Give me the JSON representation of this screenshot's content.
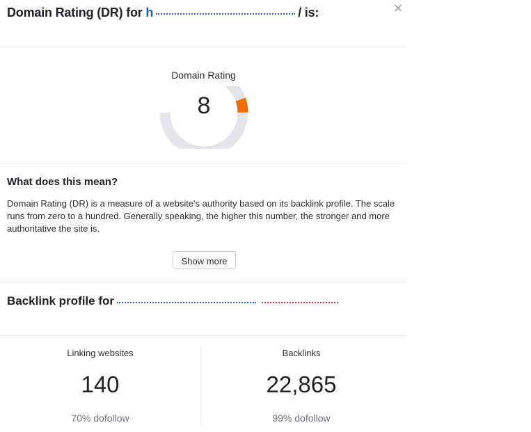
{
  "header": {
    "title_prefix": "Domain Rating (DR) for",
    "title_link": "h",
    "title_suffix": "/ is:",
    "close_glyph": "×"
  },
  "domain_rating": {
    "label": "Domain Rating",
    "value": 8,
    "max": 100,
    "fill_color": "#f06c00",
    "track_color": "#e4e5ea"
  },
  "meaning": {
    "heading": "What does this mean?",
    "body": "Domain Rating (DR) is a measure of a website's authority based on its backlink profile. The scale runs from zero to a hundred. Generally speaking, the higher this number, the stronger and more authoritative the site is.",
    "show_more_label": "Show more"
  },
  "backlink_profile": {
    "title_prefix": "Backlink profile for"
  },
  "stats": {
    "linking_websites": {
      "label": "Linking websites",
      "value": "140",
      "sub": "70% dofollow"
    },
    "backlinks": {
      "label": "Backlinks",
      "value": "22,865",
      "sub": "99% dofollow"
    }
  }
}
